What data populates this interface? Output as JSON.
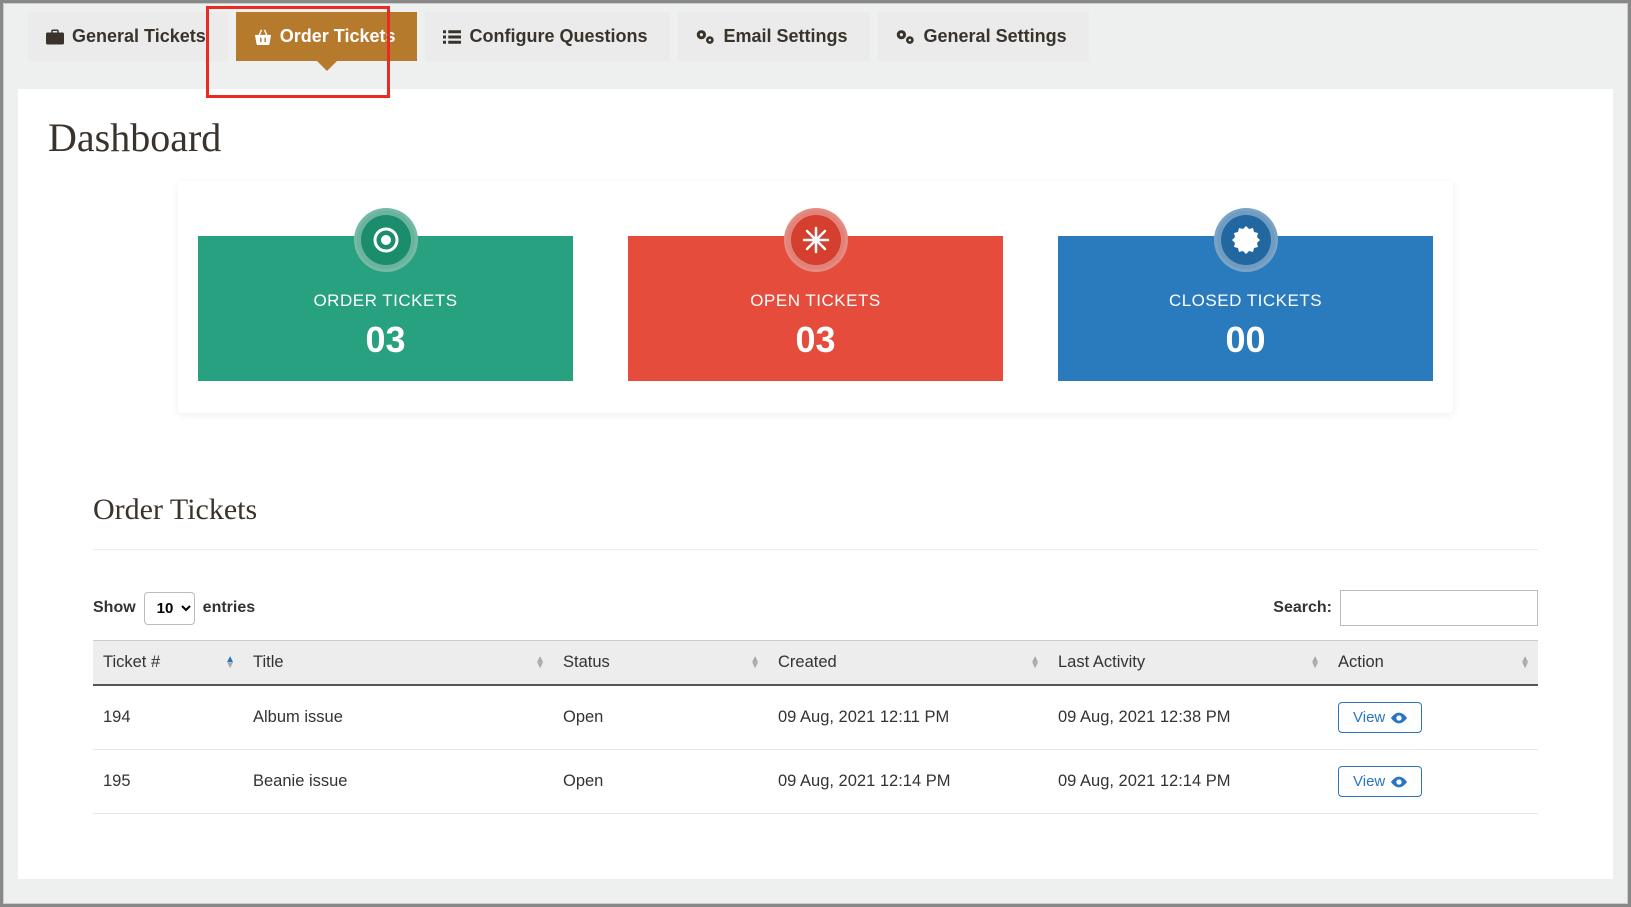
{
  "tabs": [
    {
      "id": "general-tickets",
      "label": "General Tickets",
      "icon": "briefcase-icon"
    },
    {
      "id": "order-tickets",
      "label": "Order Tickets",
      "icon": "basket-icon",
      "active": true
    },
    {
      "id": "configure-questions",
      "label": "Configure Questions",
      "icon": "list-icon"
    },
    {
      "id": "email-settings",
      "label": "Email Settings",
      "icon": "gears-icon"
    },
    {
      "id": "general-settings",
      "label": "General Settings",
      "icon": "gears-icon"
    }
  ],
  "page_title": "Dashboard",
  "stats": {
    "order": {
      "label": "ORDER TICKETS",
      "value": "03"
    },
    "open": {
      "label": "OPEN TICKETS",
      "value": "03"
    },
    "closed": {
      "label": "CLOSED TICKETS",
      "value": "00"
    }
  },
  "section_title": "Order Tickets",
  "table_controls": {
    "show_label": "Show",
    "entries_label": "entries",
    "page_size": "10",
    "search_label": "Search:",
    "search_value": ""
  },
  "columns": {
    "ticket": "Ticket #",
    "title": "Title",
    "status": "Status",
    "created": "Created",
    "last_activity": "Last Activity",
    "action": "Action"
  },
  "action_label": "View",
  "rows": [
    {
      "ticket": "194",
      "title": "Album issue",
      "status": "Open",
      "created": "09 Aug, 2021 12:11 PM",
      "last_activity": "09 Aug, 2021 12:38 PM"
    },
    {
      "ticket": "195",
      "title": "Beanie issue",
      "status": "Open",
      "created": "09 Aug, 2021 12:14 PM",
      "last_activity": "09 Aug, 2021 12:14 PM"
    }
  ]
}
